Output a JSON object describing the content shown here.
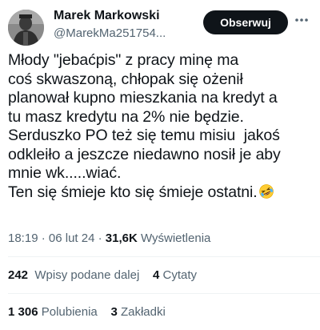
{
  "author": {
    "display_name": "Marek Markowski",
    "handle": "@MarekMa251754..."
  },
  "follow_button": {
    "label": "Obserwuj"
  },
  "tweet": {
    "lines": [
      "Młody \"jebaćpis\" z pracy minę ma",
      "coś skwaszoną, chłopak się ożenił",
      "planował kupno mieszkania na kredyt a",
      "tu masz kredytu na 2% nie będzie.",
      "Serduszko PO też się temu misiu  jakoś",
      "odkleiło a jeszcze niedawno nosił je aby",
      "mnie wk.....wiać.",
      "Ten się śmieje kto się śmieje ostatni."
    ],
    "emoji": "rolling-on-floor-laughing-emoji"
  },
  "meta": {
    "time": "18:19",
    "separator": "·",
    "date": "06 lut 24",
    "views_count": "31,6K",
    "views_label": "Wyświetlenia"
  },
  "stats": {
    "reposts_count": "242",
    "reposts_label": "Wpisy podane dalej",
    "quotes_count": "4",
    "quotes_label": "Cytaty",
    "likes_count": "1 306",
    "likes_label": "Polubienia",
    "bookmarks_count": "3",
    "bookmarks_label": "Zakładki"
  },
  "colors": {
    "text": "#0f1419",
    "secondary": "#536471",
    "button_bg": "#0f1419",
    "divider": "#eff3f4"
  }
}
